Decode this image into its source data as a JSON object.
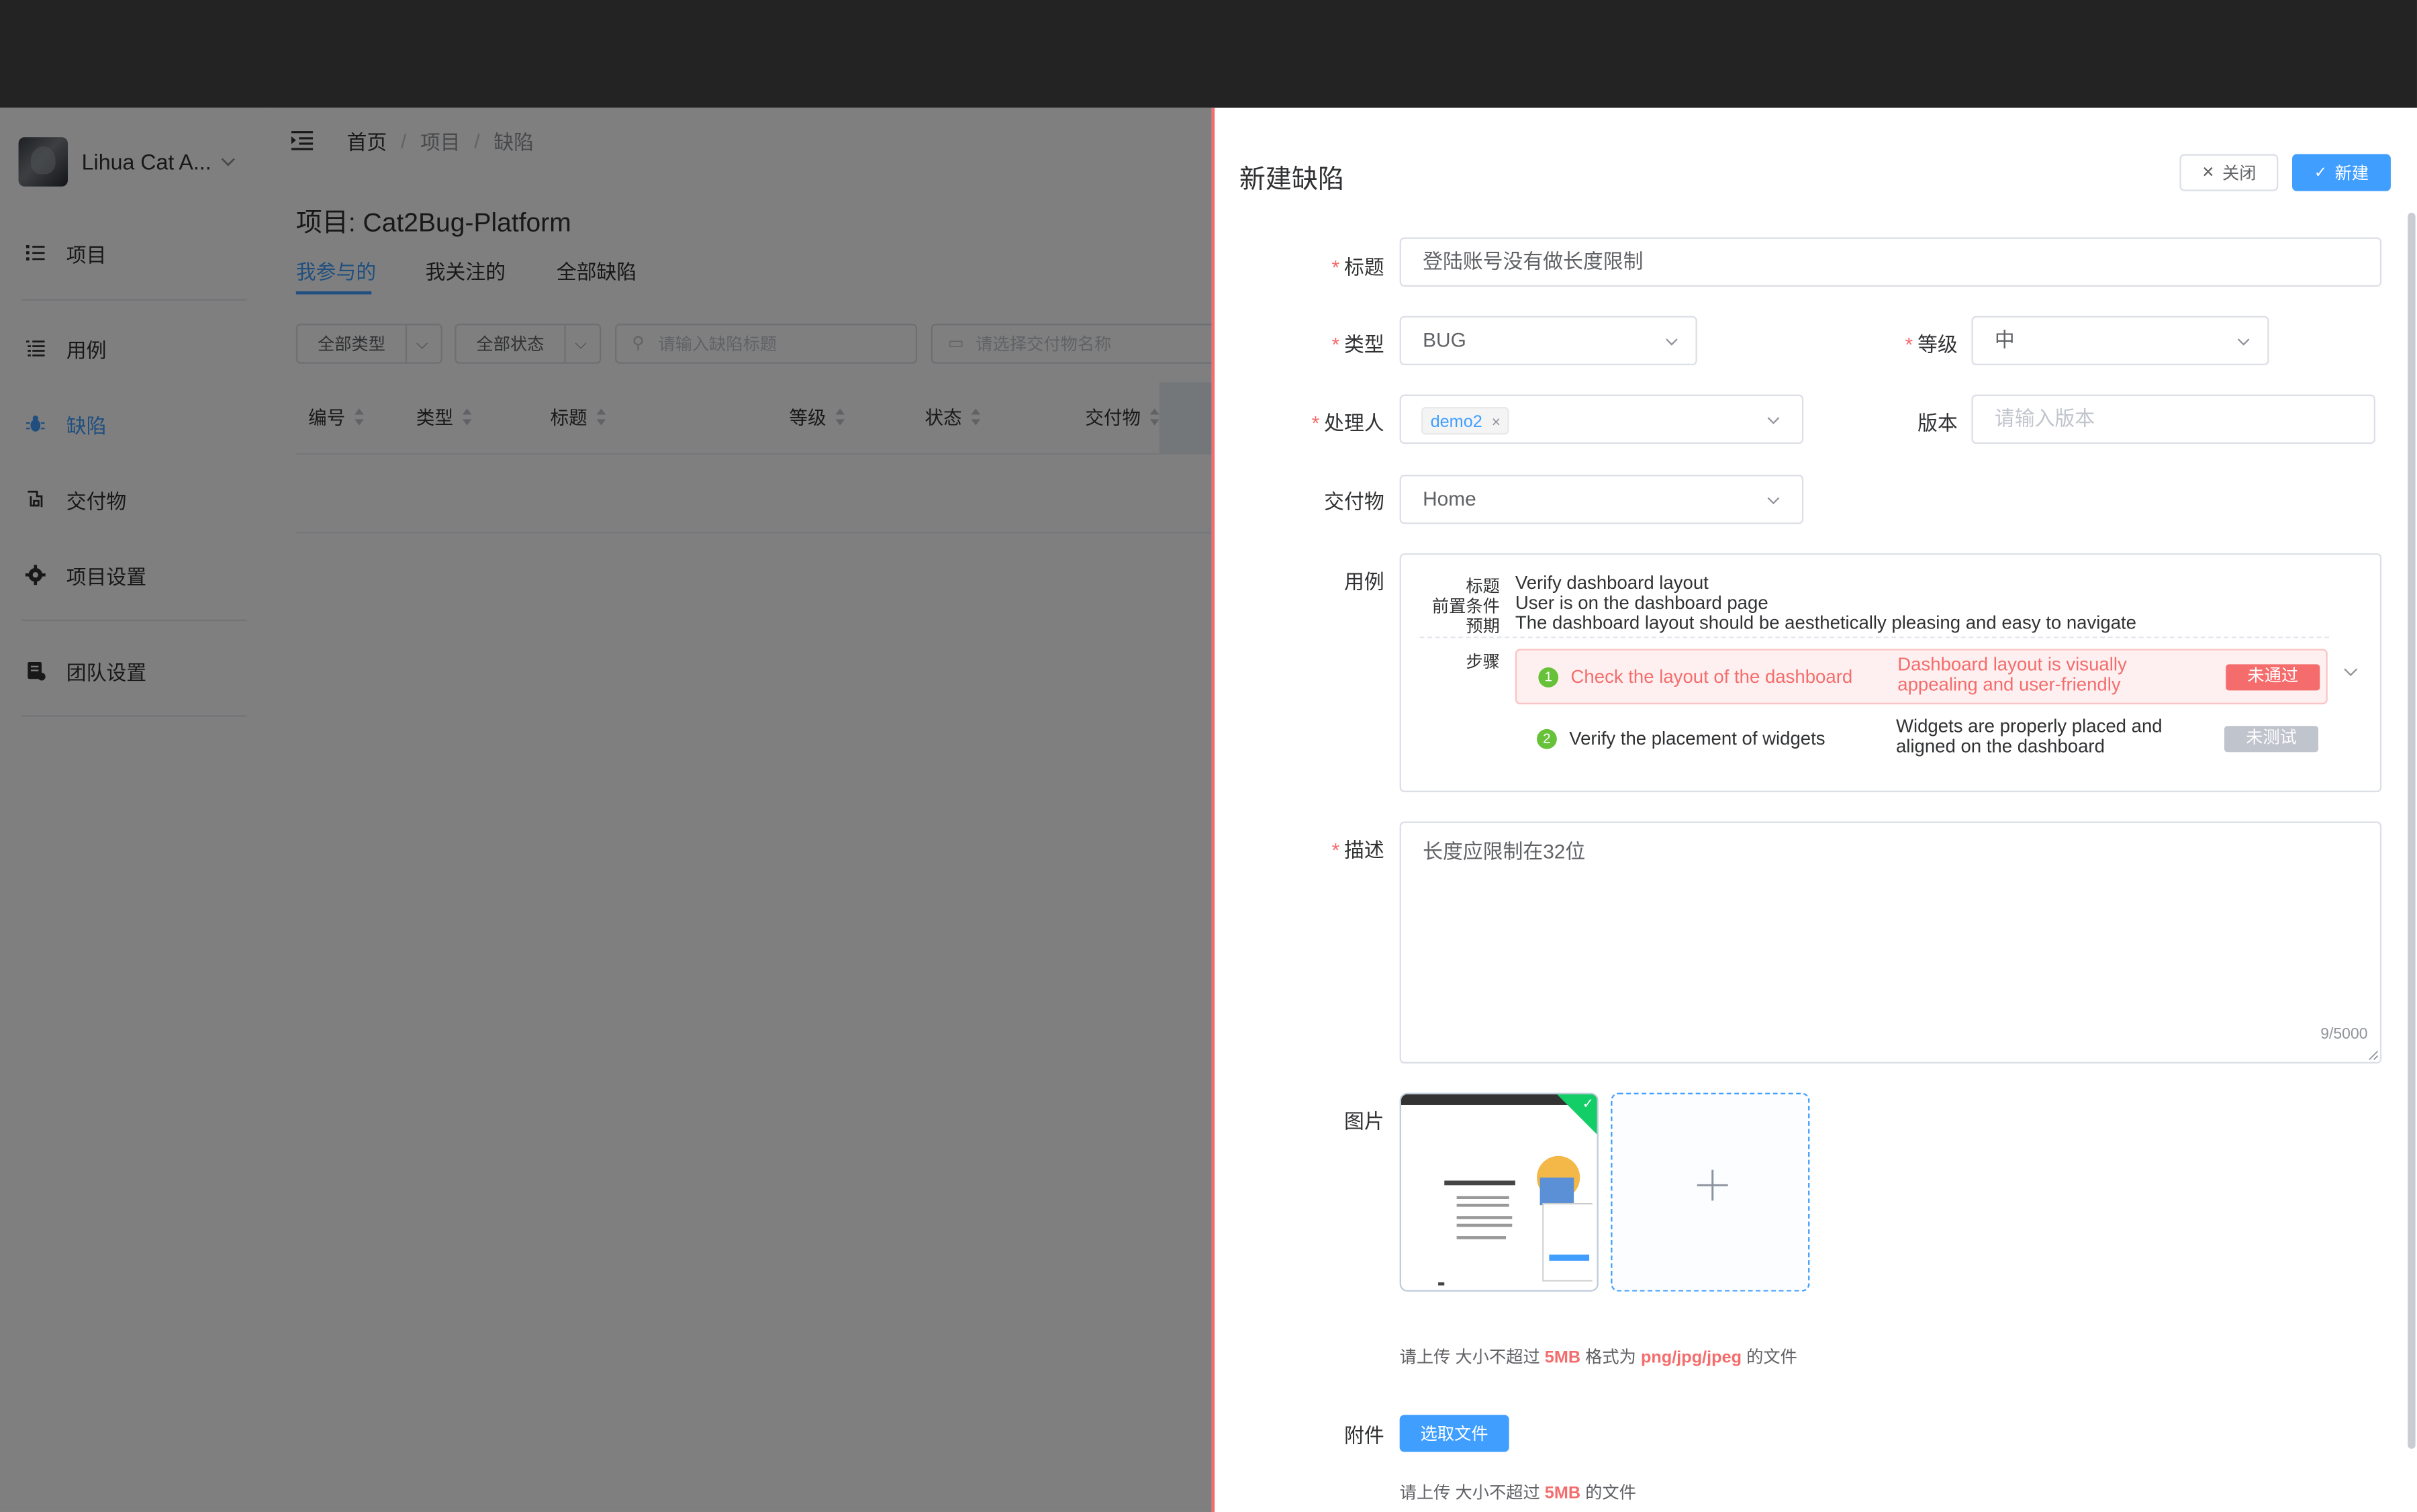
{
  "sidebar": {
    "team_name": "Lihua Cat A...",
    "items": [
      {
        "label": "项目",
        "icon": "list-icon"
      },
      {
        "label": "用例",
        "icon": "list-check-icon"
      },
      {
        "label": "缺陷",
        "icon": "bug-icon"
      },
      {
        "label": "交付物",
        "icon": "box-icon"
      },
      {
        "label": "项目设置",
        "icon": "gear-icon"
      },
      {
        "label": "团队设置",
        "icon": "document-icon"
      }
    ],
    "active": "缺陷"
  },
  "breadcrumb": [
    "首页",
    "项目",
    "缺陷"
  ],
  "project": {
    "title": "项目: Cat2Bug-Platform",
    "tabs": [
      "我参与的",
      "我关注的",
      "全部缺陷"
    ],
    "filters": {
      "type": "全部类型",
      "status": "全部状态",
      "title_placeholder": "请输入缺陷标题",
      "deliverable_placeholder": "请选择交付物名称"
    },
    "columns": [
      "编号",
      "类型",
      "标题",
      "等级",
      "状态",
      "交付物"
    ]
  },
  "drawer": {
    "title": "新建缺陷",
    "close_label": "关闭",
    "create_label": "新建",
    "form": {
      "title_label": "标题",
      "title_value": "登陆账号没有做长度限制",
      "type_label": "类型",
      "type_value": "BUG",
      "level_label": "等级",
      "level_value": "中",
      "handler_label": "处理人",
      "handler_tag": "demo2",
      "version_label": "版本",
      "version_placeholder": "请输入版本",
      "deliverable_label": "交付物",
      "deliverable_value": "Home",
      "case_label": "用例",
      "desc_label": "描述",
      "desc_value": "长度应限制在32位",
      "desc_count": "9/5000",
      "image_label": "图片",
      "attach_label": "附件",
      "select_file_label": "选取文件"
    },
    "case": {
      "title_key": "标题",
      "title_value": "Verify dashboard layout",
      "precondition_key": "前置条件",
      "precondition_value": "User is on the dashboard page",
      "expected_key": "预期",
      "expected_value": "The dashboard layout should be aesthetically pleasing and easy to navigate",
      "steps_key": "步骤",
      "steps": [
        {
          "num": "1",
          "action": "Check the layout of the dashboard",
          "expected": "Dashboard layout is visually appealing and user-friendly",
          "status": "未通过"
        },
        {
          "num": "2",
          "action": "Verify the placement of widgets",
          "expected": "Widgets are properly placed and aligned on the dashboard",
          "status": "未测试"
        }
      ]
    },
    "image_tip": {
      "p1": "请上传 大小不超过 ",
      "size": "5MB",
      "p2": " 格式为 ",
      "formats": "png/jpg/jpeg",
      "p3": " 的文件"
    },
    "file_tip": {
      "p1": "请上传 大小不超过 ",
      "size": "5MB",
      "p3": " 的文件"
    }
  }
}
